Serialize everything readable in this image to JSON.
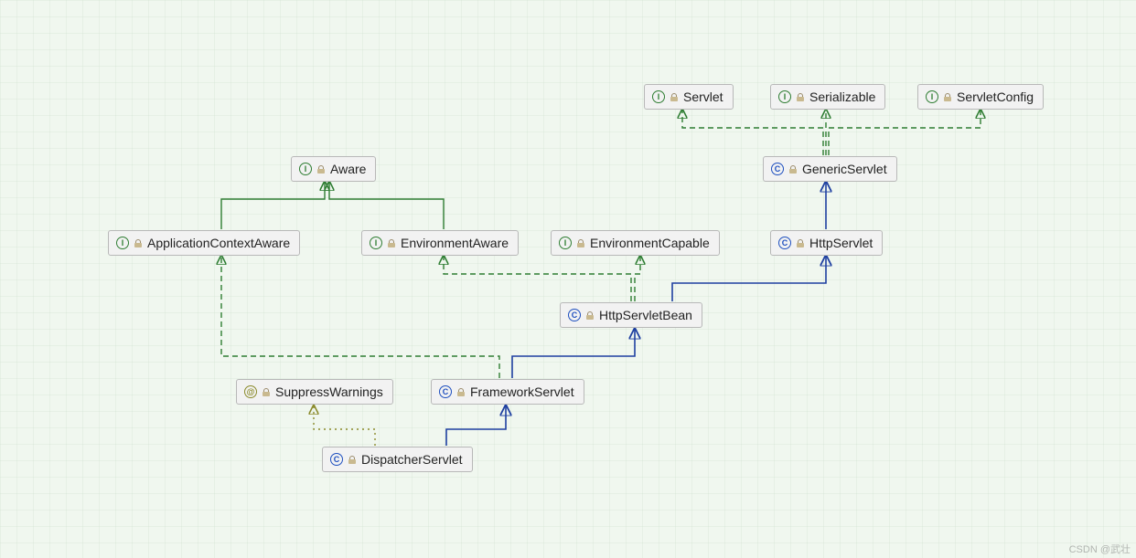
{
  "watermark": "CSDN @武壮",
  "nodes": {
    "servlet": {
      "label": "Servlet",
      "kind": "interface"
    },
    "serializable": {
      "label": "Serializable",
      "kind": "interface"
    },
    "servletConfig": {
      "label": "ServletConfig",
      "kind": "interface"
    },
    "aware": {
      "label": "Aware",
      "kind": "interface"
    },
    "genericServlet": {
      "label": "GenericServlet",
      "kind": "class"
    },
    "appCtxAware": {
      "label": "ApplicationContextAware",
      "kind": "interface"
    },
    "envAware": {
      "label": "EnvironmentAware",
      "kind": "interface"
    },
    "envCapable": {
      "label": "EnvironmentCapable",
      "kind": "interface"
    },
    "httpServlet": {
      "label": "HttpServlet",
      "kind": "class"
    },
    "httpServletBean": {
      "label": "HttpServletBean",
      "kind": "class"
    },
    "suppressWarnings": {
      "label": "SuppressWarnings",
      "kind": "annotation"
    },
    "frameworkServlet": {
      "label": "FrameworkServlet",
      "kind": "class"
    },
    "dispatcherServlet": {
      "label": "DispatcherServlet",
      "kind": "class"
    }
  },
  "edges": [
    {
      "from": "genericServlet",
      "to": "servlet",
      "style": "implements"
    },
    {
      "from": "genericServlet",
      "to": "serializable",
      "style": "implements"
    },
    {
      "from": "genericServlet",
      "to": "servletConfig",
      "style": "implements"
    },
    {
      "from": "httpServlet",
      "to": "genericServlet",
      "style": "extends"
    },
    {
      "from": "appCtxAware",
      "to": "aware",
      "style": "extendsIface"
    },
    {
      "from": "envAware",
      "to": "aware",
      "style": "extendsIface"
    },
    {
      "from": "httpServletBean",
      "to": "envAware",
      "style": "implements"
    },
    {
      "from": "httpServletBean",
      "to": "envCapable",
      "style": "implements"
    },
    {
      "from": "httpServletBean",
      "to": "httpServlet",
      "style": "extends"
    },
    {
      "from": "frameworkServlet",
      "to": "appCtxAware",
      "style": "implements"
    },
    {
      "from": "frameworkServlet",
      "to": "httpServletBean",
      "style": "extends"
    },
    {
      "from": "dispatcherServlet",
      "to": "frameworkServlet",
      "style": "extends"
    },
    {
      "from": "dispatcherServlet",
      "to": "suppressWarnings",
      "style": "annotation"
    }
  ]
}
